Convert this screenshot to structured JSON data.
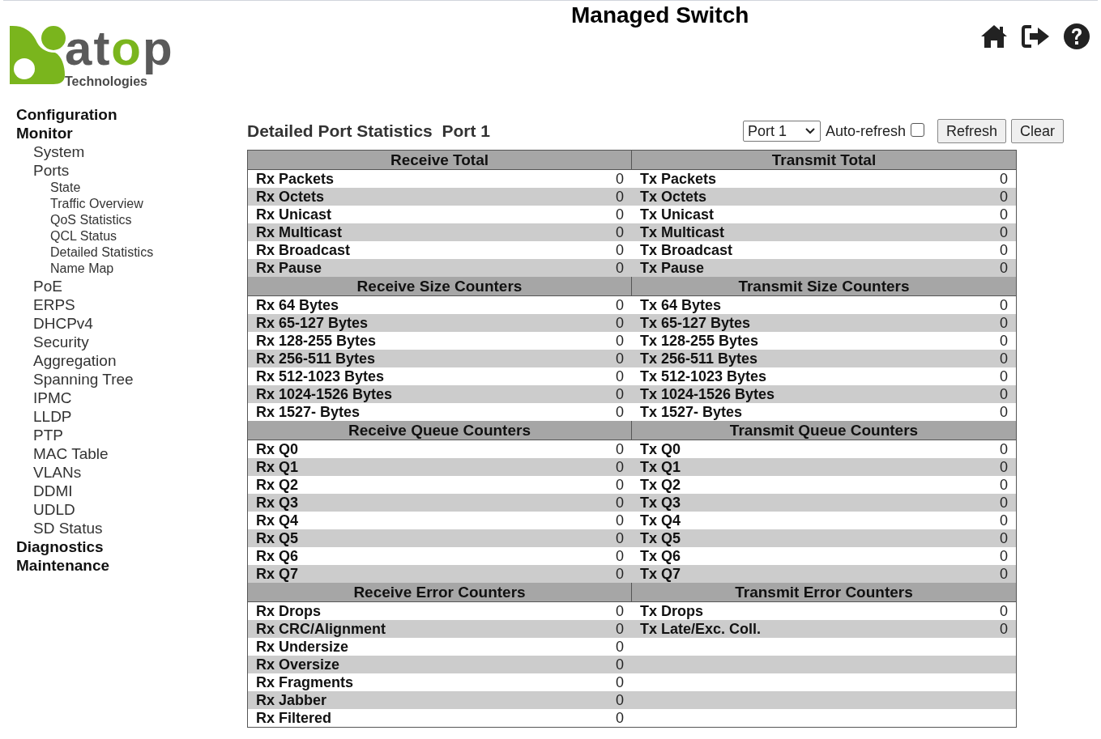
{
  "header": {
    "title": "Managed Switch",
    "logo": {
      "wordmark": "atop",
      "tagline": "Technologies"
    }
  },
  "sidebar": {
    "items": [
      {
        "label": "Configuration"
      },
      {
        "label": "Monitor",
        "children": [
          {
            "label": "System"
          },
          {
            "label": "Ports",
            "children": [
              {
                "label": "State"
              },
              {
                "label": "Traffic Overview"
              },
              {
                "label": "QoS Statistics"
              },
              {
                "label": "QCL Status"
              },
              {
                "label": "Detailed Statistics"
              },
              {
                "label": "Name Map"
              }
            ]
          },
          {
            "label": "PoE"
          },
          {
            "label": "ERPS"
          },
          {
            "label": "DHCPv4"
          },
          {
            "label": "Security"
          },
          {
            "label": "Aggregation"
          },
          {
            "label": "Spanning Tree"
          },
          {
            "label": "IPMC"
          },
          {
            "label": "LLDP"
          },
          {
            "label": "PTP"
          },
          {
            "label": "MAC Table"
          },
          {
            "label": "VLANs"
          },
          {
            "label": "DDMI"
          },
          {
            "label": "UDLD"
          },
          {
            "label": "SD Status"
          }
        ]
      },
      {
        "label": "Diagnostics"
      },
      {
        "label": "Maintenance"
      }
    ]
  },
  "page": {
    "title": "Detailed Port Statistics  Port 1",
    "port_select": "Port 1",
    "auto_refresh": {
      "label": "Auto-refresh",
      "checked": false
    },
    "buttons": [
      "Refresh",
      "Clear"
    ]
  },
  "table": {
    "sections": [
      {
        "rx_title": "Receive Total",
        "tx_title": "Transmit Total",
        "rx": [
          [
            "Rx Packets",
            "0"
          ],
          [
            "Rx Octets",
            "0"
          ],
          [
            "Rx Unicast",
            "0"
          ],
          [
            "Rx Multicast",
            "0"
          ],
          [
            "Rx Broadcast",
            "0"
          ],
          [
            "Rx Pause",
            "0"
          ]
        ],
        "tx": [
          [
            "Tx Packets",
            "0"
          ],
          [
            "Tx Octets",
            "0"
          ],
          [
            "Tx Unicast",
            "0"
          ],
          [
            "Tx Multicast",
            "0"
          ],
          [
            "Tx Broadcast",
            "0"
          ],
          [
            "Tx Pause",
            "0"
          ]
        ]
      },
      {
        "rx_title": "Receive Size Counters",
        "tx_title": "Transmit Size Counters",
        "rx": [
          [
            "Rx 64 Bytes",
            "0"
          ],
          [
            "Rx 65-127 Bytes",
            "0"
          ],
          [
            "Rx 128-255 Bytes",
            "0"
          ],
          [
            "Rx 256-511 Bytes",
            "0"
          ],
          [
            "Rx 512-1023 Bytes",
            "0"
          ],
          [
            "Rx 1024-1526 Bytes",
            "0"
          ],
          [
            "Rx 1527- Bytes",
            "0"
          ]
        ],
        "tx": [
          [
            "Tx 64 Bytes",
            "0"
          ],
          [
            "Tx 65-127 Bytes",
            "0"
          ],
          [
            "Tx 128-255 Bytes",
            "0"
          ],
          [
            "Tx 256-511 Bytes",
            "0"
          ],
          [
            "Tx 512-1023 Bytes",
            "0"
          ],
          [
            "Tx 1024-1526 Bytes",
            "0"
          ],
          [
            "Tx 1527- Bytes",
            "0"
          ]
        ]
      },
      {
        "rx_title": "Receive Queue Counters",
        "tx_title": "Transmit Queue Counters",
        "rx": [
          [
            "Rx Q0",
            "0"
          ],
          [
            "Rx Q1",
            "0"
          ],
          [
            "Rx Q2",
            "0"
          ],
          [
            "Rx Q3",
            "0"
          ],
          [
            "Rx Q4",
            "0"
          ],
          [
            "Rx Q5",
            "0"
          ],
          [
            "Rx Q6",
            "0"
          ],
          [
            "Rx Q7",
            "0"
          ]
        ],
        "tx": [
          [
            "Tx Q0",
            "0"
          ],
          [
            "Tx Q1",
            "0"
          ],
          [
            "Tx Q2",
            "0"
          ],
          [
            "Tx Q3",
            "0"
          ],
          [
            "Tx Q4",
            "0"
          ],
          [
            "Tx Q5",
            "0"
          ],
          [
            "Tx Q6",
            "0"
          ],
          [
            "Tx Q7",
            "0"
          ]
        ]
      },
      {
        "rx_title": "Receive Error Counters",
        "tx_title": "Transmit Error Counters",
        "rx": [
          [
            "Rx Drops",
            "0"
          ],
          [
            "Rx CRC/Alignment",
            "0"
          ],
          [
            "Rx Undersize",
            "0"
          ],
          [
            "Rx Oversize",
            "0"
          ],
          [
            "Rx Fragments",
            "0"
          ],
          [
            "Rx Jabber",
            "0"
          ],
          [
            "Rx Filtered",
            "0"
          ]
        ],
        "tx": [
          [
            "Tx Drops",
            "0"
          ],
          [
            "Tx Late/Exc. Coll.",
            "0"
          ]
        ]
      }
    ]
  }
}
